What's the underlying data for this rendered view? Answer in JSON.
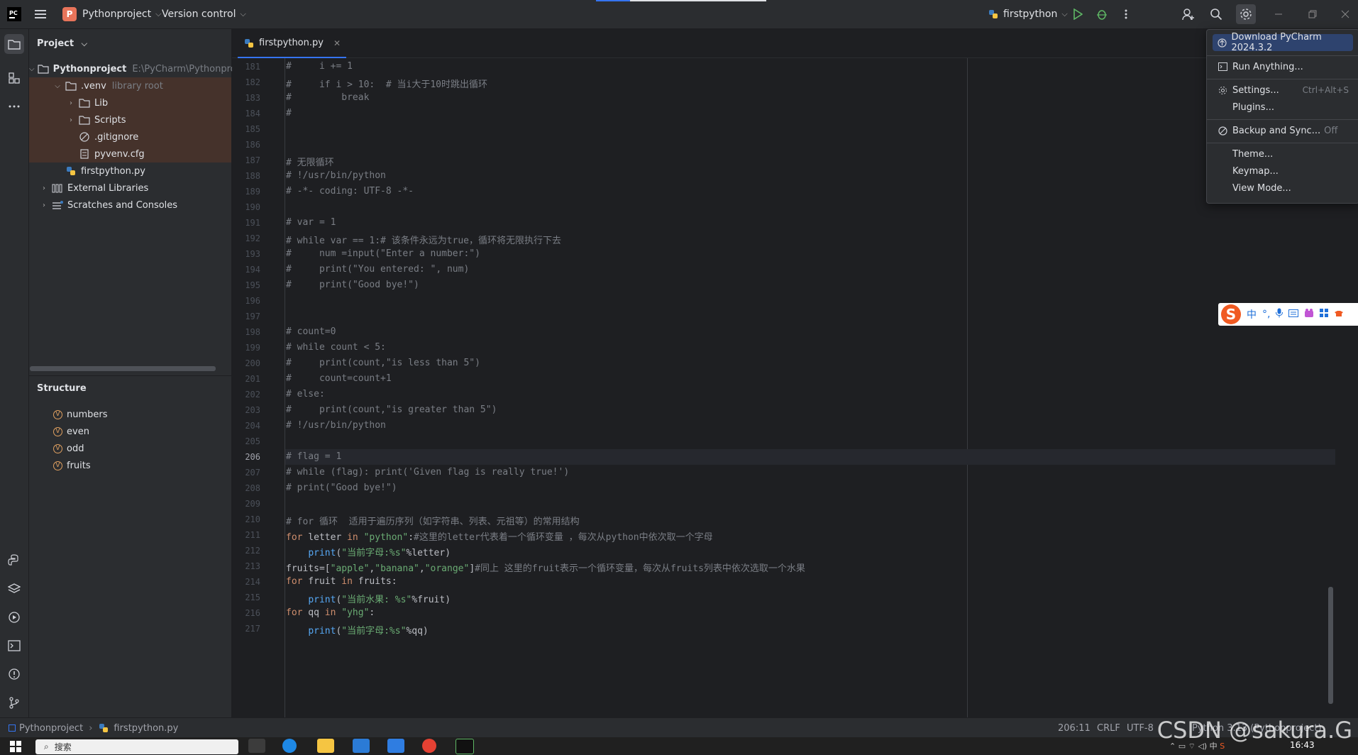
{
  "colors": {
    "accent": "#3574f0",
    "highlight_row": "#45322b",
    "project_badge": "#e8745a",
    "keyword": "#cf8e6d",
    "string": "#6aab73",
    "comment": "#7a7e85",
    "function": "#56a8f5"
  },
  "header": {
    "app_logo": "PC",
    "project_badge_letter": "P",
    "project_name": "Pythonproject",
    "version_control": "Version control",
    "run_config": "firstpython"
  },
  "icons": [
    "pycharm-logo-icon",
    "hamburger-menu-icon",
    "python-file-icon",
    "run-icon",
    "debug-icon",
    "more-vertical-icon",
    "add-user-icon",
    "search-icon",
    "gear-icon",
    "minimize-icon",
    "restore-icon",
    "close-icon",
    "folder-icon",
    "structure-icon",
    "more-icon",
    "python-console-icon",
    "layers-icon",
    "services-icon",
    "terminal-icon",
    "problems-icon",
    "git-icon"
  ],
  "project_panel": {
    "title": "Project",
    "tree": [
      {
        "label": "Pythonproject",
        "hint": "E:\\PyCharm\\Pythonproje",
        "icon": "folder-icon"
      },
      {
        "label": ".venv",
        "hint": "library root",
        "icon": "folder-icon"
      },
      {
        "label": "Lib",
        "icon": "folder-icon"
      },
      {
        "label": "Scripts",
        "icon": "folder-icon"
      },
      {
        "label": ".gitignore",
        "icon": "ignore-icon"
      },
      {
        "label": "pyvenv.cfg",
        "icon": "config-file-icon"
      },
      {
        "label": "firstpython.py",
        "icon": "python-file-icon"
      },
      {
        "label": "External Libraries",
        "icon": "library-icon"
      },
      {
        "label": "Scratches and Consoles",
        "icon": "scratch-icon"
      }
    ]
  },
  "structure": {
    "title": "Structure",
    "badge": "V",
    "items": [
      "numbers",
      "even",
      "odd",
      "fruits"
    ]
  },
  "editor": {
    "tab_label": "firstpython.py",
    "current_line": "206",
    "lines": [
      {
        "n": "181",
        "t": "#     i += 1"
      },
      {
        "n": "182",
        "t": "#     if i > 10:  # 当i大于10时跳出循环"
      },
      {
        "n": "183",
        "t": "#         break"
      },
      {
        "n": "184",
        "t": "#"
      },
      {
        "n": "185",
        "t": ""
      },
      {
        "n": "186",
        "t": ""
      },
      {
        "n": "187",
        "t": "# 无限循环"
      },
      {
        "n": "188",
        "t": "# !/usr/bin/python"
      },
      {
        "n": "189",
        "t": "# -*- coding: UTF-8 -*-"
      },
      {
        "n": "190",
        "t": ""
      },
      {
        "n": "191",
        "t": "# var = 1"
      },
      {
        "n": "192",
        "t": "# while var == 1:# 该条件永远为true，循环将无限执行下去"
      },
      {
        "n": "193",
        "t": "#     num =input(\"Enter a number:\")"
      },
      {
        "n": "194",
        "t": "#     print(\"You entered: \", num)"
      },
      {
        "n": "195",
        "t": "#     print(\"Good bye!\")"
      },
      {
        "n": "196",
        "t": ""
      },
      {
        "n": "197",
        "t": ""
      },
      {
        "n": "198",
        "t": "# count=0"
      },
      {
        "n": "199",
        "t": "# while count < 5:"
      },
      {
        "n": "200",
        "t": "#     print(count,\"is less than 5\")"
      },
      {
        "n": "201",
        "t": "#     count=count+1"
      },
      {
        "n": "202",
        "t": "# else:"
      },
      {
        "n": "203",
        "t": "#     print(count,\"is greater than 5\")"
      },
      {
        "n": "204",
        "t": "# !/usr/bin/python"
      },
      {
        "n": "205",
        "t": ""
      },
      {
        "n": "206",
        "t": "# flag = 1"
      },
      {
        "n": "207",
        "t": "# while (flag): print('Given flag is really true!')"
      },
      {
        "n": "208",
        "t": "# print(\"Good bye!\")"
      },
      {
        "n": "209",
        "t": ""
      },
      {
        "n": "210",
        "t": "# for 循环  适用于遍历序列（如字符串、列表、元祖等）的常用结构"
      },
      {
        "n": "211",
        "tokens": [
          [
            "kw",
            "for"
          ],
          [
            "plain",
            " letter "
          ],
          [
            "kw",
            "in"
          ],
          [
            "plain",
            " "
          ],
          [
            "str",
            "\"python\""
          ],
          [
            "plain",
            ":"
          ],
          [
            "com",
            "#这里的letter代表着一个循环变量 ，每次从python中依次取一个字母"
          ]
        ]
      },
      {
        "n": "212",
        "tokens": [
          [
            "plain",
            "    "
          ],
          [
            "fn",
            "print"
          ],
          [
            "plain",
            "("
          ],
          [
            "str",
            "\"当前字母:%s\""
          ],
          [
            "plain",
            "%letter)"
          ]
        ]
      },
      {
        "n": "213",
        "tokens": [
          [
            "plain",
            "fruits=["
          ],
          [
            "str",
            "\"apple\""
          ],
          [
            "plain",
            ","
          ],
          [
            "str",
            "\"banana\""
          ],
          [
            "plain",
            ","
          ],
          [
            "str",
            "\"orange\""
          ],
          [
            "plain",
            "]"
          ],
          [
            "com",
            "#同上 这里的fruit表示一个循环变量，每次从fruits列表中依次选取一个水果"
          ]
        ]
      },
      {
        "n": "214",
        "tokens": [
          [
            "kw",
            "for"
          ],
          [
            "plain",
            " fruit "
          ],
          [
            "kw",
            "in"
          ],
          [
            "plain",
            " fruits:"
          ]
        ]
      },
      {
        "n": "215",
        "tokens": [
          [
            "plain",
            "    "
          ],
          [
            "fn",
            "print"
          ],
          [
            "plain",
            "("
          ],
          [
            "str",
            "\"当前水果: %s\""
          ],
          [
            "plain",
            "%fruit)"
          ]
        ]
      },
      {
        "n": "216",
        "tokens": [
          [
            "kw",
            "for"
          ],
          [
            "plain",
            " qq "
          ],
          [
            "kw",
            "in"
          ],
          [
            "plain",
            " "
          ],
          [
            "str",
            "\"yhg\""
          ],
          [
            "plain",
            ":"
          ]
        ]
      },
      {
        "n": "217",
        "tokens": [
          [
            "plain",
            "    "
          ],
          [
            "fn",
            "print"
          ],
          [
            "plain",
            "("
          ],
          [
            "str",
            "\"当前字母:%s\""
          ],
          [
            "plain",
            "%qq)"
          ]
        ]
      }
    ]
  },
  "settings_menu": {
    "items": [
      {
        "label": "Download PyCharm 2024.3.2",
        "icon": "update-icon"
      },
      {
        "label": "Run Anything...",
        "icon": "run-anything-icon"
      },
      {
        "label": "Settings...",
        "shortcut": "Ctrl+Alt+S",
        "icon": "gear-icon"
      },
      {
        "label": "Plugins..."
      },
      {
        "label": "Backup and Sync...",
        "suffix": "Off",
        "icon": "sync-icon"
      },
      {
        "label": "Theme..."
      },
      {
        "label": "Keymap..."
      },
      {
        "label": "View Mode..."
      }
    ]
  },
  "status_bar": {
    "breadcrumb_project": "Pythonproject",
    "breadcrumb_file": "firstpython.py",
    "position": "206:11",
    "line_sep": "CRLF",
    "encoding": "UTF-8",
    "interpreter": "Python 3.13 (Pythonproject)"
  },
  "ime": {
    "lang": "中"
  },
  "taskbar": {
    "search_placeholder": "搜索",
    "time": "16:43"
  },
  "watermark": "CSDN @sakura.G"
}
